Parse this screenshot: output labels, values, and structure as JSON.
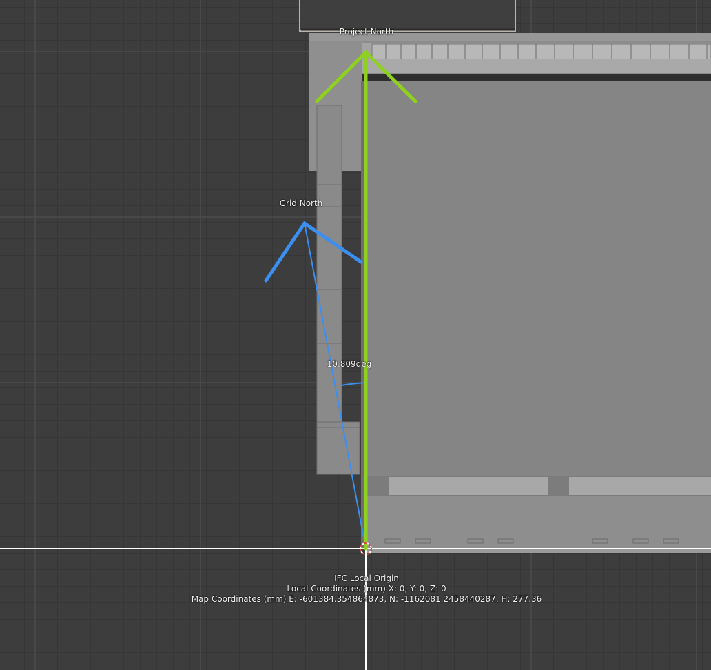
{
  "viewport": {
    "project_north_label": "Project North",
    "grid_north_label": "Grid North",
    "angle_label": "10.809deg",
    "origin": {
      "title": "IFC Local Origin",
      "local_coordinates": "Local Coordinates (mm) X: 0, Y: 0, Z: 0",
      "map_coordinates": "Map Coordinates (mm) E: -601384.354864873, N: -1162081.2458440287, H: 277.36"
    }
  },
  "colors": {
    "background": "#3d3d3d",
    "project_north": "#8fd11f",
    "grid_north": "#3b8ff0",
    "origin_axes": "#ffffff"
  }
}
